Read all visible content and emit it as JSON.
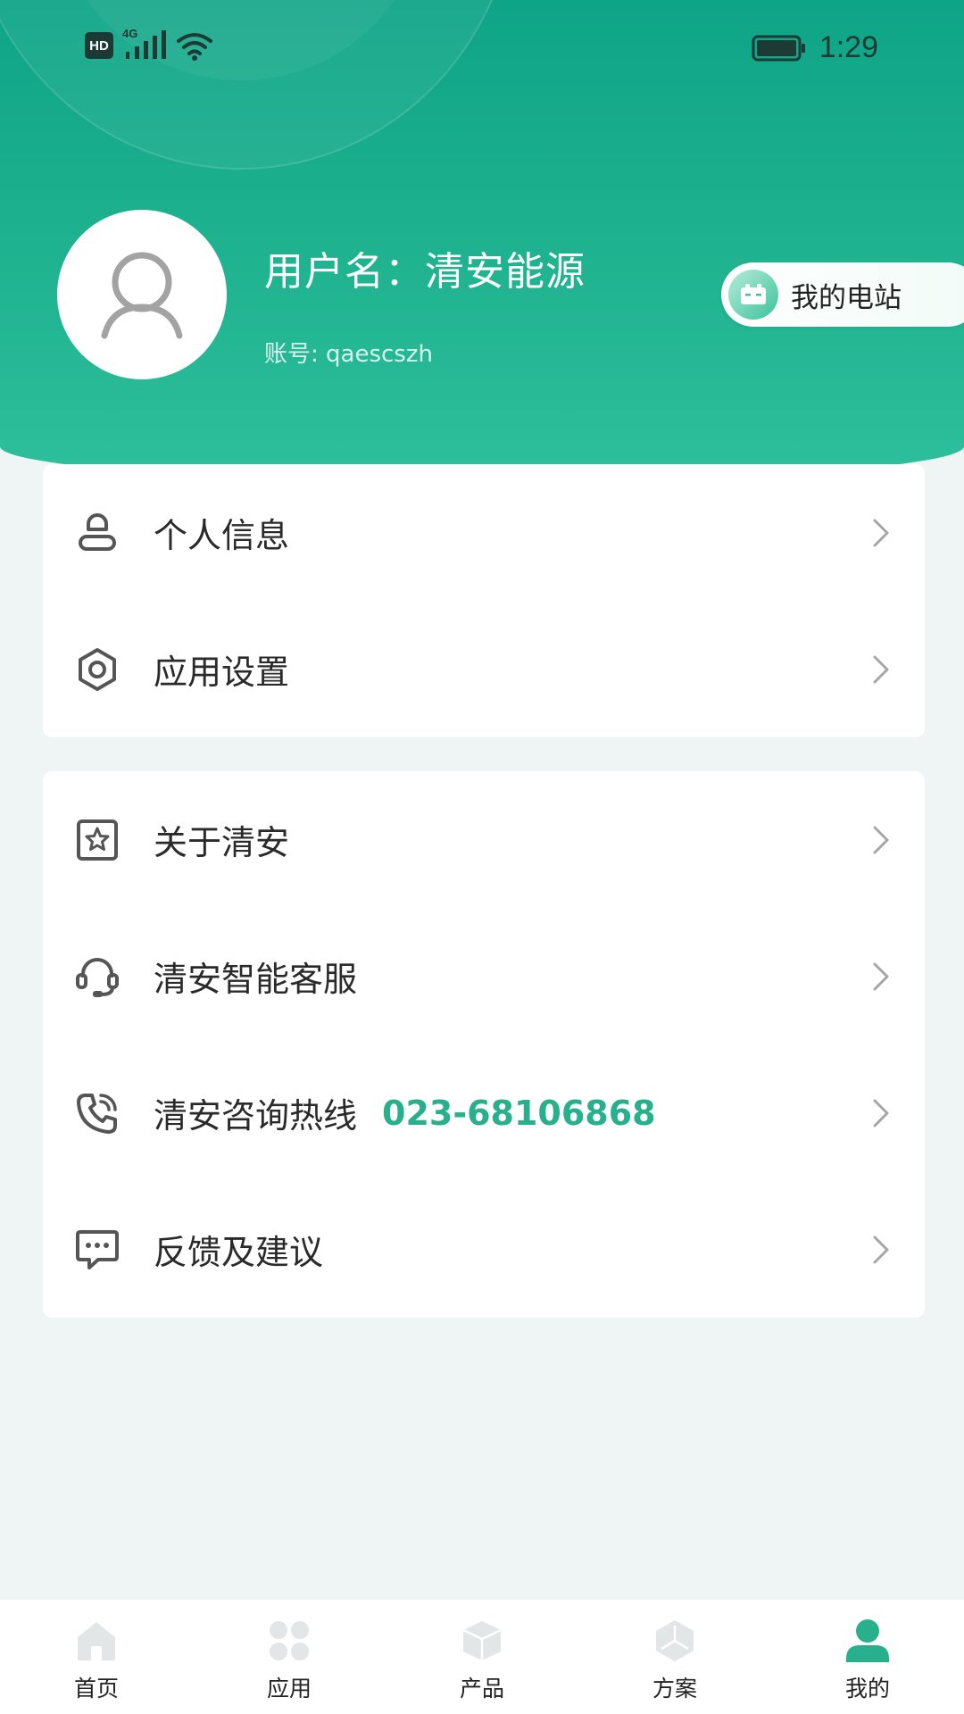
{
  "status_bar": {
    "network_badge": "HD",
    "network_type": "4G",
    "time": "1:29"
  },
  "profile": {
    "username": "用户名：清安能源",
    "account": "账号: qaescszh",
    "station_button": "我的电站"
  },
  "menu_group1": [
    {
      "label": "个人信息",
      "icon": "user-icon"
    },
    {
      "label": "应用设置",
      "icon": "settings-icon"
    }
  ],
  "menu_group2": [
    {
      "label": "关于清安",
      "icon": "star-badge-icon"
    },
    {
      "label": "清安智能客服",
      "icon": "headset-icon"
    },
    {
      "label": "清安咨询热线",
      "value": "023-68106868",
      "icon": "phone-icon"
    },
    {
      "label": "反馈及建议",
      "icon": "chat-icon"
    }
  ],
  "bottom_nav": [
    {
      "label": "首页",
      "icon": "home-icon",
      "active": false
    },
    {
      "label": "应用",
      "icon": "apps-icon",
      "active": false
    },
    {
      "label": "产品",
      "icon": "box-icon",
      "active": false
    },
    {
      "label": "方案",
      "icon": "cube-icon",
      "active": false
    },
    {
      "label": "我的",
      "icon": "person-icon",
      "active": true
    }
  ],
  "colors": {
    "accent": "#28b08d",
    "header_top": "#0ea487",
    "background": "#eff4f4",
    "nav_inactive": "#e3e6e6"
  }
}
